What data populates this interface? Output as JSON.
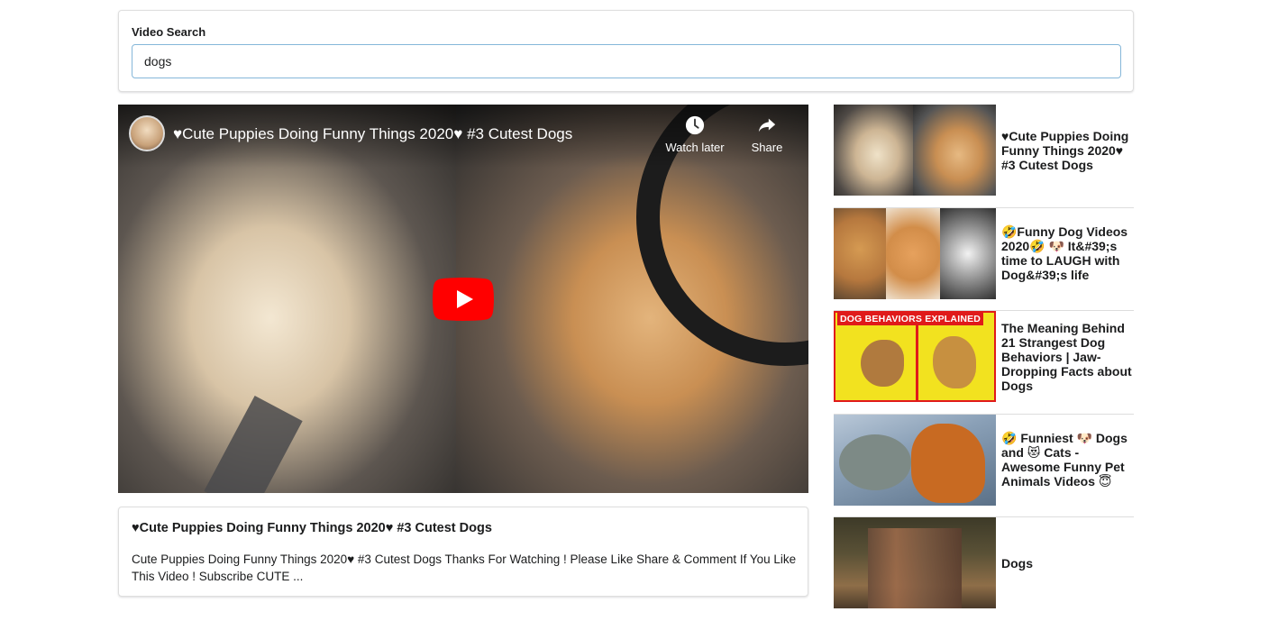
{
  "search": {
    "label": "Video Search",
    "value": "dogs"
  },
  "player": {
    "title": "♥Cute Puppies Doing Funny Things 2020♥ #3 Cutest Dogs",
    "watch_later_label": "Watch later",
    "share_label": "Share"
  },
  "detail": {
    "title": "♥Cute Puppies Doing Funny Things 2020♥ #3 Cutest Dogs",
    "description": "Cute Puppies Doing Funny Things 2020♥ #3 Cutest Dogs Thanks For Watching ! Please Like Share & Comment If You Like This Video ! Subscribe CUTE ..."
  },
  "video_list": [
    {
      "title": "♥Cute Puppies Doing Funny Things 2020♥ #3 Cutest Dogs"
    },
    {
      "title": "🤣Funny Dog Videos 2020🤣 🐶 It&#39;s time to LAUGH with Dog&#39;s life"
    },
    {
      "title": "The Meaning Behind 21 Strangest Dog Behaviors | Jaw-Dropping Facts about Dogs",
      "thumb_banner": "DOG BEHAVIORS EXPLAINED"
    },
    {
      "title": "🤣 Funniest 🐶 Dogs and 😻 Cats - Awesome Funny Pet Animals Videos 😇"
    },
    {
      "title": "Dogs"
    }
  ],
  "colors": {
    "input_focus_border": "#85b7d9",
    "play_button": "#ff0000",
    "divider": "#dddddd"
  }
}
